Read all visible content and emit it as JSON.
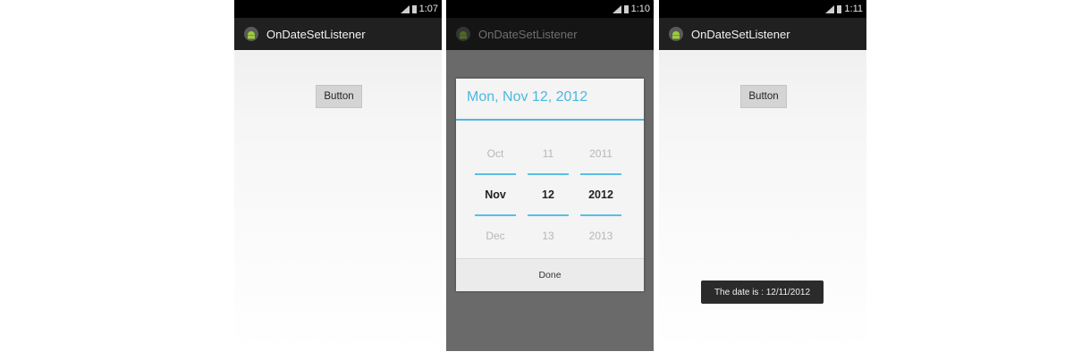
{
  "phones": [
    {
      "status_time": "1:07",
      "app_title": "OnDateSetListener",
      "button_label": "Button"
    },
    {
      "status_time": "1:10",
      "app_title": "OnDateSetListener",
      "dialog": {
        "title": "Mon, Nov 12, 2012",
        "month": {
          "prev": "Oct",
          "current": "Nov",
          "next": "Dec"
        },
        "day": {
          "prev": "11",
          "current": "12",
          "next": "13"
        },
        "year": {
          "prev": "2011",
          "current": "2012",
          "next": "2013"
        },
        "done_label": "Done"
      }
    },
    {
      "status_time": "1:11",
      "app_title": "OnDateSetListener",
      "button_label": "Button",
      "toast": "The date is : 12/11/2012"
    }
  ],
  "colors": {
    "accent": "#4ab9e0",
    "action_bar": "#202020",
    "overlay": "#6a6a6a"
  },
  "icons": {
    "app": "android-icon",
    "signal": "signal-icon",
    "battery": "battery-icon"
  }
}
